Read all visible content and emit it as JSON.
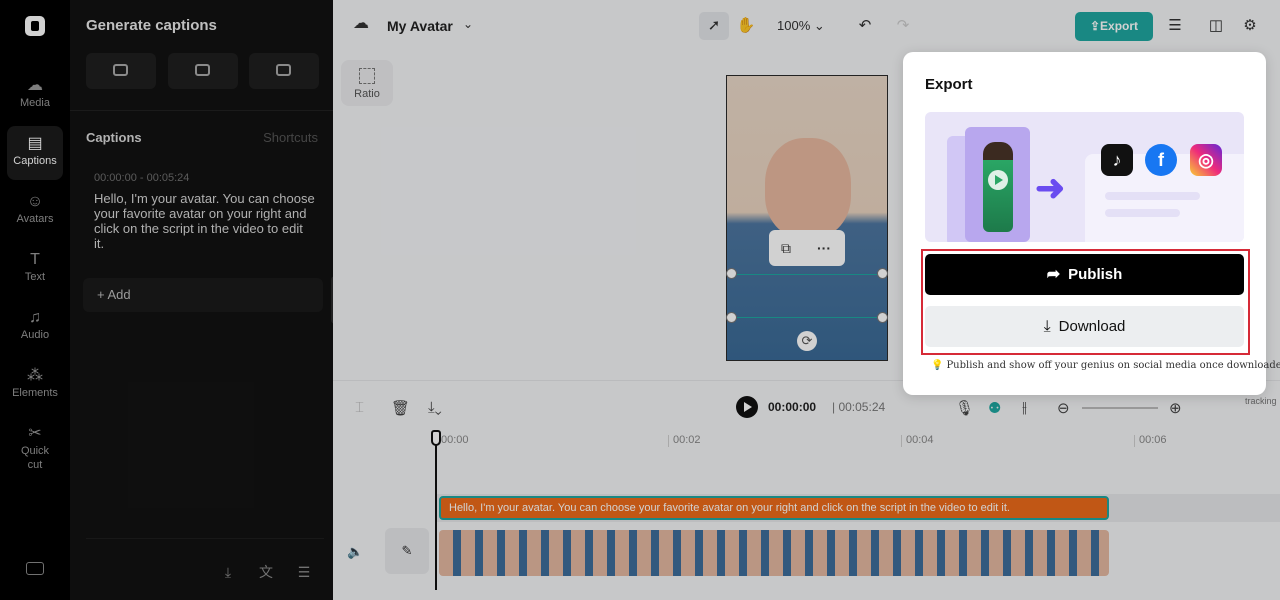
{
  "rail": {
    "items": [
      {
        "label": "Media",
        "icon": "☁"
      },
      {
        "label": "Captions",
        "icon": "▤"
      },
      {
        "label": "Avatars",
        "icon": "☺"
      },
      {
        "label": "Text",
        "icon": "T"
      },
      {
        "label": "Audio",
        "icon": "♫"
      },
      {
        "label": "Elements",
        "icon": "⁂"
      },
      {
        "label": "Quick",
        "label2": "cut",
        "icon": "✂"
      }
    ]
  },
  "panel": {
    "title": "Generate captions",
    "captions_heading": "Captions",
    "shortcuts_label": "Shortcuts",
    "caption": {
      "time": "00:00:00 - 00:05:24",
      "text": "Hello, I'm your avatar. You can choose your favorite avatar on your right and click on the script in the video to edit it."
    },
    "add_label": "Add"
  },
  "topbar": {
    "project_name": "My Avatar",
    "zoom": "100%",
    "export_label": "Export"
  },
  "canvas": {
    "ratio_label": "Ratio"
  },
  "timeline": {
    "current_time": "00:00:00",
    "duration": "00:05:24",
    "tracking_label": "tracking",
    "ruler": [
      "00:00",
      "00:02",
      "00:04",
      "00:06"
    ],
    "caption_clip_text": "Hello, I'm your avatar. You can choose your favorite avatar on your right and click on the script in the video to edit it."
  },
  "export_popup": {
    "title": "Export",
    "publish_label": "Publish",
    "download_label": "Download",
    "tip": "Publish and show off your genius on social media once downloaded.",
    "social_icons": [
      "tiktok-icon",
      "facebook-icon",
      "instagram-icon"
    ]
  },
  "colors": {
    "accent": "#1fa7a0",
    "caption_clip": "#ec6b1a",
    "highlight": "#d62a37"
  }
}
